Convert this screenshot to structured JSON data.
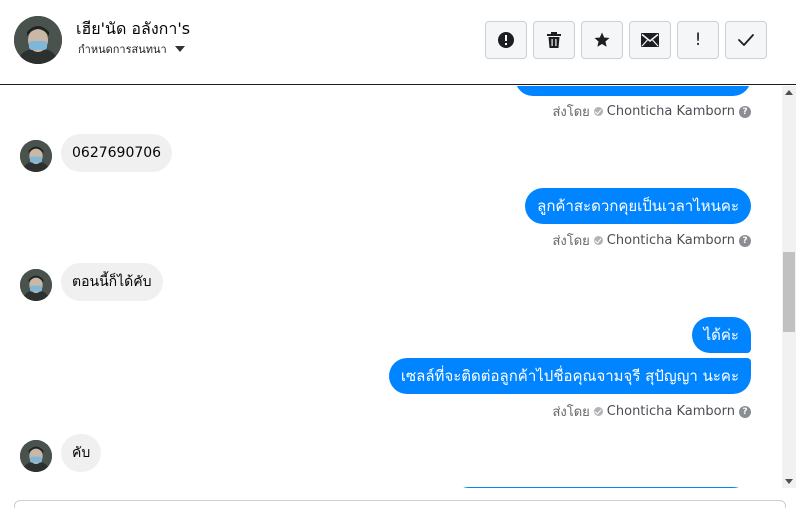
{
  "header": {
    "contact_name": "เฮีย'นัด อลังกา's",
    "conversation_settings": "กำหนดการสนทนา",
    "toolbar": [
      {
        "name": "mark-spam-button",
        "icon": "alert-circle-icon"
      },
      {
        "name": "delete-button",
        "icon": "trash-icon"
      },
      {
        "name": "star-button",
        "icon": "star-icon"
      },
      {
        "name": "mark-unread-button",
        "icon": "envelope-icon"
      },
      {
        "name": "follow-up-button",
        "icon": "exclamation-icon",
        "glyph": "!"
      },
      {
        "name": "mark-done-button",
        "icon": "checkmark-icon"
      }
    ]
  },
  "messages": {
    "sent_by_label": "ส่งโดย",
    "agent_name": "Chonticha Kamborn",
    "help_glyph": "?",
    "incoming_1": "0627690706",
    "outgoing_1": "ลูกค้าสะดวกคุยเป็นเวลาไหนคะ",
    "incoming_2": "ตอนนี้ก็ได้คับ",
    "outgoing_2": "ได้ค่ะ",
    "outgoing_3": "เซลล์ที่จะติดต่อลูกค้าไปชื่อคุณจามจุรี สุปัญญา นะคะ",
    "incoming_3": "คับ"
  },
  "colors": {
    "outgoing_bubble": "#0084ff",
    "incoming_bubble": "#f0f0f0",
    "meta_text": "#65676b"
  }
}
